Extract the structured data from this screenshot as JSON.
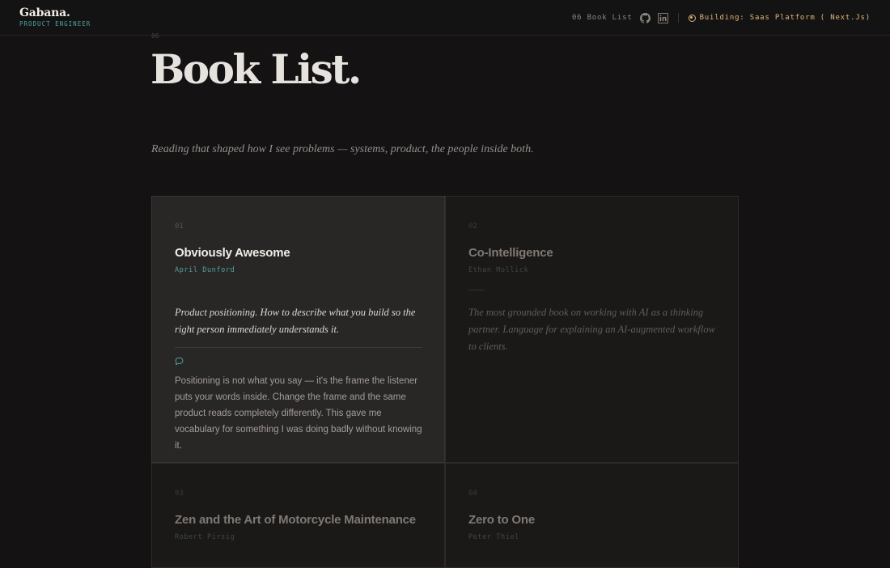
{
  "header": {
    "brand_name": "Gabana.",
    "brand_role": "PRODUCT ENGINEER",
    "crumb": "06 Book List",
    "icons": [
      "github-icon",
      "linkedin-icon"
    ],
    "status_text": "Building: Saas Platform ( Next.Js)",
    "status_color": "#d9b47c"
  },
  "page": {
    "index": "06",
    "title": "Book List.",
    "subtitle": "Reading that shaped how I see problems — systems, product, the people inside both."
  },
  "books": [
    {
      "num": "01",
      "title": "Obviously Awesome",
      "author": "April Dunford",
      "blurb": "Product positioning. How to describe what you build so the right person immediately understands it.",
      "note": "Positioning is not what you say — it's the frame the listener puts your words inside. Change the frame and the same product reads completely differently. This gave me vocabulary for something I was doing badly without knowing it."
    },
    {
      "num": "02",
      "title": "Co-Intelligence",
      "author": "Ethan Mollick",
      "blurb": "The most grounded book on working with AI as a thinking partner. Language for explaining an AI-augmented workflow to clients."
    },
    {
      "num": "03",
      "title": "Zen and the Art of Motorcycle Maintenance",
      "author": "Robert Pirsig"
    },
    {
      "num": "04",
      "title": "Zero to One",
      "author": "Peter Thiel"
    }
  ],
  "colors": {
    "accent_teal": "#4fa39a",
    "accent_gold": "#dfb77a",
    "background": "#141213"
  }
}
